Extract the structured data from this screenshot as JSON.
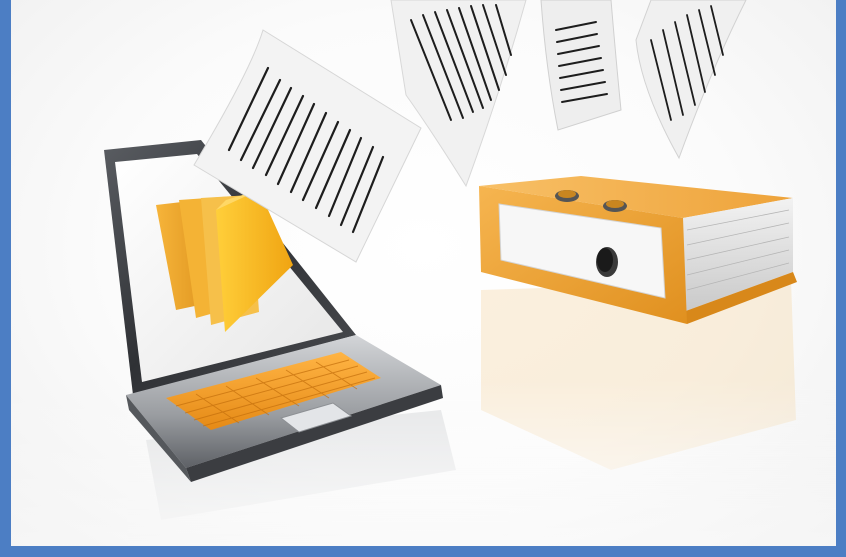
{
  "frame": {
    "border_color": "#4c7ec4",
    "background_color": "#ffffff"
  },
  "scene": {
    "subject": "laptop-with-folders-and-flying-papers",
    "objects": [
      "laptop",
      "folders-on-screen",
      "flying-paper-sheets",
      "orange-binder"
    ],
    "colors": {
      "folder_orange": "#f3a72a",
      "folder_yellow": "#ffc21a",
      "binder_orange": "#f2a93a",
      "keyboard_orange": "#f39a25",
      "laptop_silver": "#a8aaad",
      "screen_bezel": "#3a3c40",
      "paper": "#f4f4f4",
      "text_lines": "#1a1a1a"
    }
  }
}
